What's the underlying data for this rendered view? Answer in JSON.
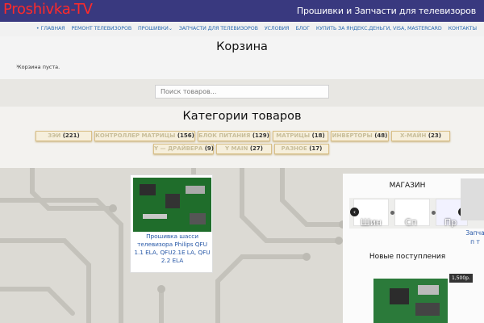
{
  "header": {
    "logo": "Proshivka-TV",
    "tagline": "Прошивки и Запчасти для телевизоров"
  },
  "nav": {
    "items": [
      {
        "label": "ГЛАВНАЯ"
      },
      {
        "label": "РЕМОНТ ТЕЛЕВИЗОРОВ"
      },
      {
        "label": "ПРОШИВКИ"
      },
      {
        "label": "ЗАПЧАСТИ ДЛЯ ТЕЛЕВИЗОРОВ"
      },
      {
        "label": "УСЛОВИЯ"
      },
      {
        "label": "БЛОГ"
      },
      {
        "label": "КУПИТЬ ЗА ЯНДЕКС.ДЕНЬГИ, VISA, MASTERCARD"
      },
      {
        "label": "КОНТАКТЫ"
      }
    ]
  },
  "page": {
    "title": "Корзина",
    "breadcrumb": "Корзина пуста."
  },
  "search": {
    "placeholder": "Поиск товаров..."
  },
  "categories": {
    "title": "Категории товаров",
    "tags": [
      {
        "label": "ЗЭИ",
        "count": "(221)"
      },
      {
        "label": "КОНТРОЛЛЕР МАТРИЦЫ",
        "count": "(156)"
      },
      {
        "label": "БЛОК ПИТАНИЯ",
        "count": "(129)"
      },
      {
        "label": "МАТРИЦЫ",
        "count": "(18)"
      },
      {
        "label": "ИНВЕРТОРЫ",
        "count": "(48)"
      },
      {
        "label": "Х-МАЙН",
        "count": "(23)"
      },
      {
        "label": "Y — ДРАЙВЕРА",
        "count": "(9)"
      },
      {
        "label": "Y MAIN",
        "count": "(27)"
      },
      {
        "label": "РАЗНОЕ",
        "count": "(17)"
      }
    ]
  },
  "product": {
    "title": "Прошивка шасси телевизора Philips QFU 1.1 ELA, QFU2.1E LA, QFU 2.2 ELA"
  },
  "sidebar": {
    "shop_title": "МАГАЗИН",
    "carousel_labels": [
      "Шин",
      "Сп",
      "Пр"
    ],
    "side_caption": "Запча п т",
    "new_title": "Новые поступления",
    "price": "1,500р."
  },
  "colors": {
    "header_bg": "#39397f",
    "logo": "#ff2a2a",
    "link": "#2a6bb0",
    "tag_border": "#d9c089"
  }
}
